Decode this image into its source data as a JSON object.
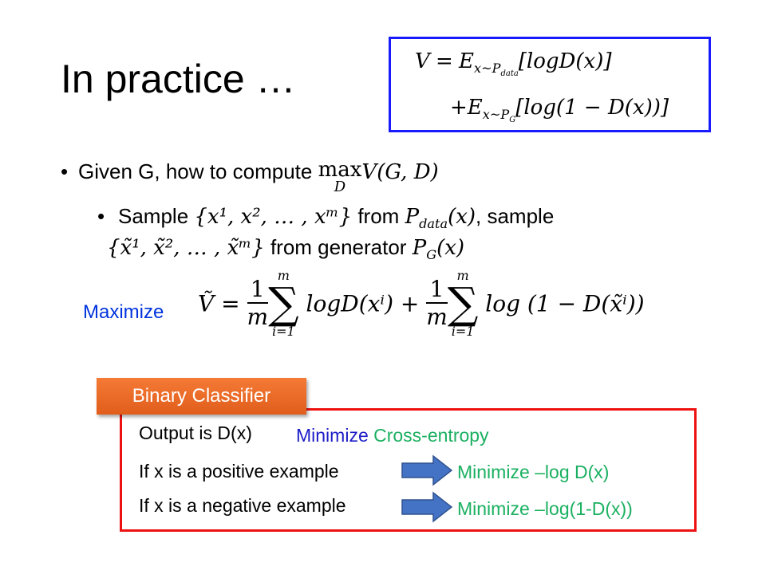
{
  "slide": {
    "title": "In practice …",
    "value_function": {
      "line1": {
        "lhs": "V",
        "eq": "=",
        "E": "E",
        "sub": "x~P",
        "subsub": "data",
        "body": "[logD(x)]"
      },
      "line2": {
        "plus": "+",
        "E": "E",
        "sub": "x~P",
        "subsub": "G",
        "body": "[log(1 − D(x))]"
      }
    },
    "bullet1": {
      "text": "Given G, how to compute ",
      "max": "max",
      "max_sub": "D",
      "expr": "V(G, D)"
    },
    "bullet2": {
      "line1_prefix": "Sample ",
      "set_x": "{x¹, x², … , xᵐ}",
      "from1": " from ",
      "P": "P",
      "P_sub": "data",
      "P_arg": "(x)",
      "line1_suffix": ", sample",
      "set_xt": "{x̃¹, x̃², … , x̃ᵐ}",
      "from2": " from generator ",
      "PG": "P",
      "PG_sub": "G",
      "PG_arg": "(x)"
    },
    "maximize": {
      "label": "Maximize",
      "lhs": "Ṽ =",
      "frac_num": "1",
      "frac_den": "m",
      "sum_top": "m",
      "sum_bot": "i=1",
      "sigma": "∑",
      "term1": "logD(xⁱ) +",
      "term2": "log (1 − D(x̃ⁱ))"
    },
    "classifier": {
      "label": "Binary Classifier",
      "output_text": "Output is D(x)",
      "min_word": "Minimize",
      "cross_entropy": "Cross-entropy",
      "pos_text": "If x is a positive example",
      "pos_result": "Minimize –log D(x)",
      "neg_text": "If x is a negative example",
      "neg_result": "Minimize –log(1-D(x))"
    }
  },
  "colors": {
    "blue_border": "#1a1aff",
    "red_border": "#ee1111",
    "orange": "#f06c2a",
    "blue_text": "#1c1cc8",
    "green_text": "#1bb061",
    "arrow": "#4472c4"
  }
}
